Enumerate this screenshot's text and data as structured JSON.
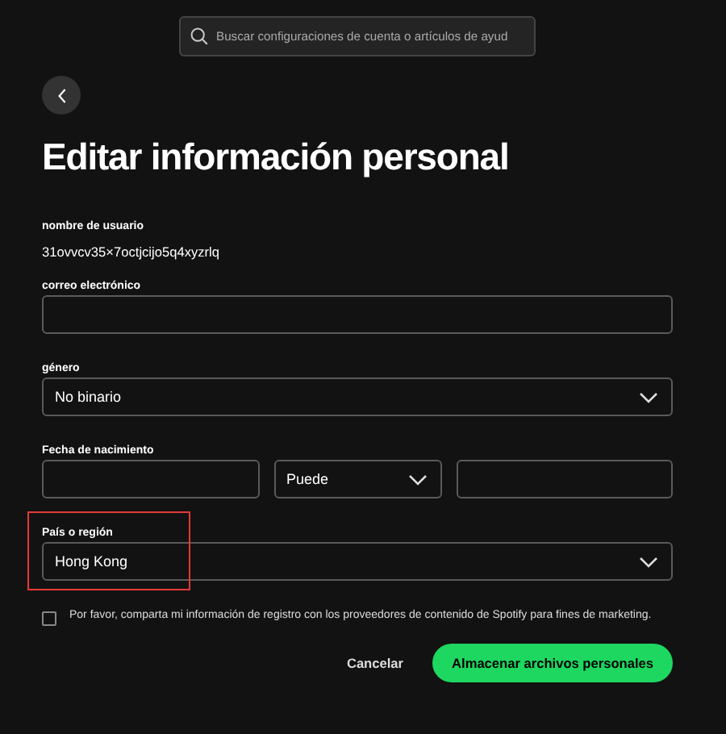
{
  "search": {
    "placeholder": "Buscar configuraciones de cuenta o artículos de ayud"
  },
  "title": "Editar información personal",
  "username": {
    "label": "nombre de usuario",
    "value": "31ovvcv35×7octjcijo5q4xyzrlq"
  },
  "fields": [
    {
      "kind": "text",
      "label": "correo electrónico",
      "highlighted": false
    },
    {
      "kind": "select",
      "label": "género",
      "value": "No binario",
      "highlighted": false
    },
    {
      "kind": "date",
      "label": "Fecha de nacimiento",
      "month": "Puede",
      "highlighted": false
    },
    {
      "kind": "select",
      "label": "País o región",
      "value": "Hong Kong",
      "highlighted": true
    }
  ],
  "consent": {
    "label": "Por favor, comparta mi información de registro con los proveedores de contenido de Spotify para fines de marketing.",
    "checked": false
  },
  "buttons": [
    {
      "kind": "secondary",
      "label": "Cancelar"
    },
    {
      "kind": "primary",
      "label": "Almacenar archivos personales"
    }
  ]
}
